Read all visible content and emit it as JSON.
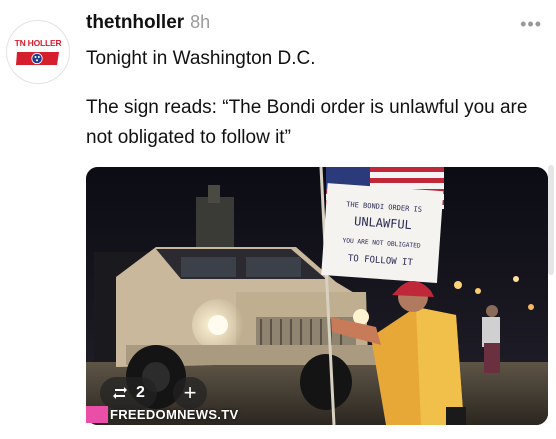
{
  "post": {
    "avatar_text": "TN HOLLER",
    "username": "thetnholler",
    "time": "8h",
    "more": "•••",
    "line1": "Tonight in Washington D.C.",
    "line2": "The sign reads: “The Bondi order is unlawful you are not obligated to follow it”"
  },
  "media": {
    "sign_text": [
      "THE BONDI ORDER IS",
      "UNLAWFUL",
      "YOU ARE NOT OBLIGATED",
      "TO FOLLOW IT"
    ],
    "watermark": "FREEDOMNEWS.TV",
    "repost_count": "2",
    "plus": "+"
  },
  "colors": {
    "brand_red": "#d61f2c",
    "brand_blue": "#1f3c8c",
    "muted": "#9a9a9a",
    "watermark_pink": "#e94fa8"
  },
  "icons": {
    "repost": "repost-icon",
    "more": "more-options-icon",
    "plus": "plus-icon"
  }
}
